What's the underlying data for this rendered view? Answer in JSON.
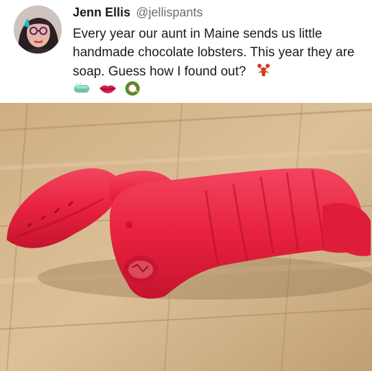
{
  "tweet": {
    "display_name": "Jenn Ellis",
    "handle": "@jellispants",
    "text": "Every year our aunt in Maine sends us little handmade chocolate lobsters. This year they are soap. Guess how I found out?",
    "inline_emoji": "lobster-emoji",
    "emoji_row": [
      "soap-bar-emoji",
      "lips-emoji",
      "wreath-emoji"
    ]
  },
  "photo": {
    "subject": "red-lobster-soap",
    "colors": {
      "wood_light": "#d8b98c",
      "wood_dark": "#a8875e",
      "soap_red": "#e8223e",
      "soap_shadow": "#b2102a"
    }
  }
}
